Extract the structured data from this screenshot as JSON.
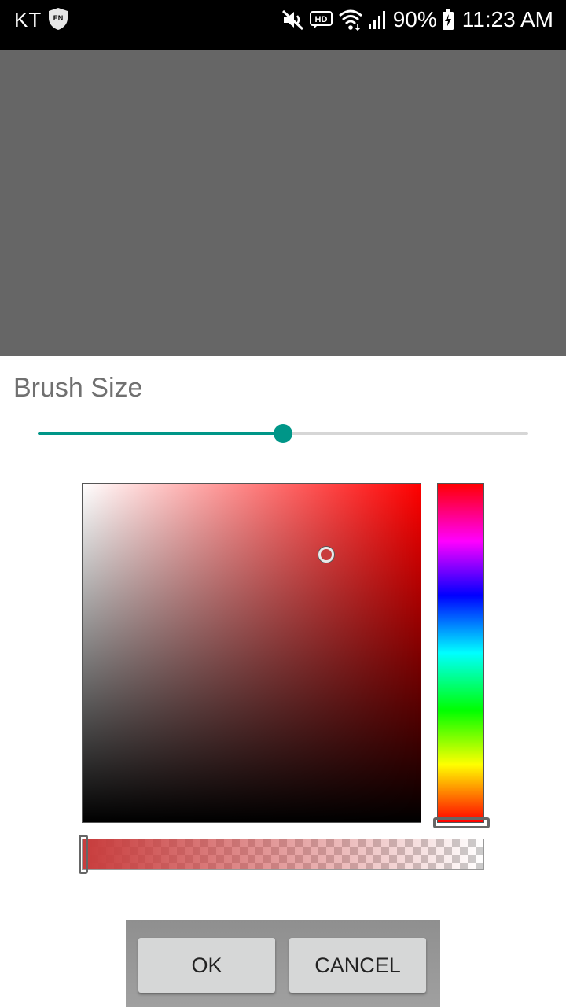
{
  "status_bar": {
    "carrier": "KT",
    "shield_badge": "EN",
    "hd_badge": "HD",
    "battery": "90%",
    "time": "11:23 AM",
    "icons": [
      "shield-icon",
      "mute-icon",
      "hd-icon",
      "wifi-icon",
      "signal-icon",
      "battery-charging-icon"
    ]
  },
  "brush": {
    "label": "Brush Size",
    "slider_value": 0.5
  },
  "color_picker": {
    "selected_color": "#c83c3c",
    "hue_color": "#ff0000",
    "saturation": 0.72,
    "value": 0.79,
    "hue_fraction": 0.0,
    "alpha": 1.0
  },
  "colors": {
    "accent": "#009688",
    "preview_background": "#666666"
  },
  "buttons": {
    "ok": "OK",
    "cancel": "CANCEL"
  }
}
